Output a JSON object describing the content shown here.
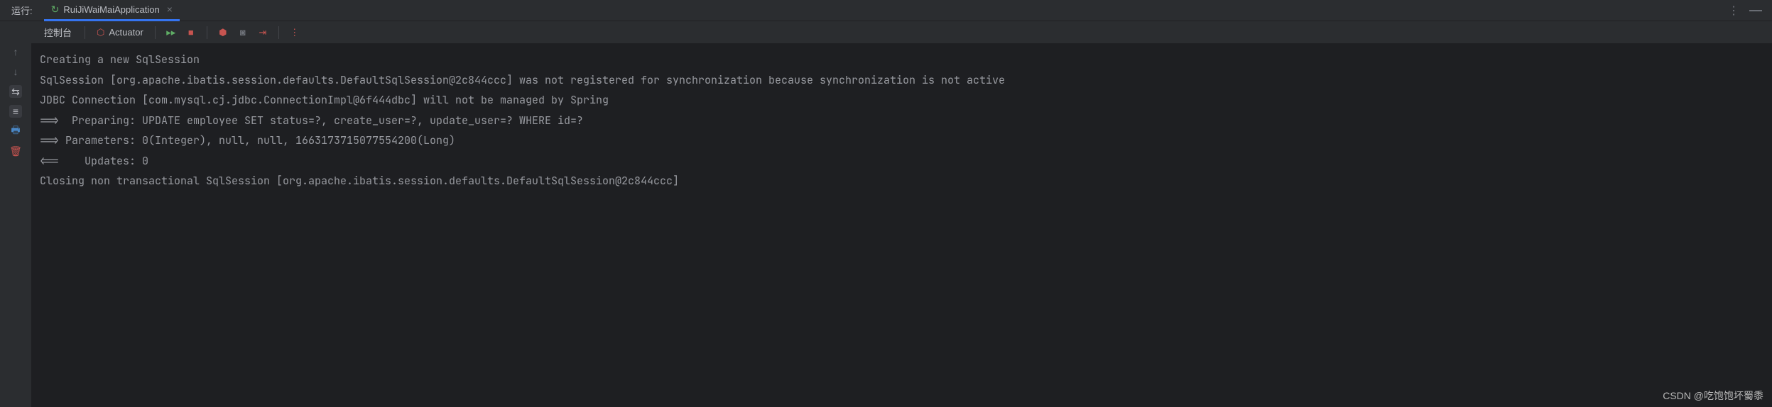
{
  "topbar": {
    "run_label": "运行:",
    "app_name": "RuiJiWaiMaiApplication"
  },
  "toolbar": {
    "tab_console": "控制台",
    "actuator_label": "Actuator"
  },
  "console": {
    "lines": [
      "Creating a new SqlSession",
      "SqlSession [org.apache.ibatis.session.defaults.DefaultSqlSession@2c844ccc] was not registered for synchronization because synchronization is not active",
      "JDBC Connection [com.mysql.cj.jdbc.ConnectionImpl@6f444dbc] will not be managed by Spring",
      "==>  Preparing: UPDATE employee SET status=?, create_user=?, update_user=? WHERE id=?",
      "==> Parameters: 0(Integer), null, null, 1663173715077554200(Long)",
      "<==    Updates: 0",
      "Closing non transactional SqlSession [org.apache.ibatis.session.defaults.DefaultSqlSession@2c844ccc]"
    ]
  },
  "watermark": "CSDN @吃饱饱坏蜀黍"
}
